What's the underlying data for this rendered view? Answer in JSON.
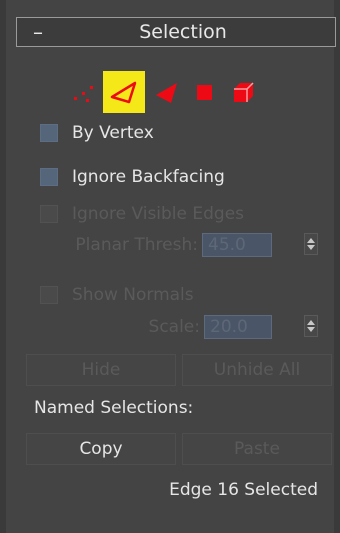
{
  "rollout": {
    "title": "Selection",
    "collapse_glyph": "–"
  },
  "selection_levels": [
    {
      "name": "vertex-icon",
      "active": false
    },
    {
      "name": "edge-icon",
      "active": true
    },
    {
      "name": "border-icon",
      "active": false
    },
    {
      "name": "polygon-icon",
      "active": false
    },
    {
      "name": "element-icon",
      "active": false
    }
  ],
  "options": {
    "by_vertex": {
      "label": "By Vertex",
      "checked": false,
      "enabled": true
    },
    "ignore_backfacing": {
      "label": "Ignore Backfacing",
      "checked": false,
      "enabled": true
    },
    "ignore_visible_edges": {
      "label": "Ignore Visible Edges",
      "checked": false,
      "enabled": false
    },
    "show_normals": {
      "label": "Show Normals",
      "checked": false,
      "enabled": false
    }
  },
  "planar_thresh": {
    "label": "Planar Thresh:",
    "value": "45.0"
  },
  "scale": {
    "label": "Scale:",
    "value": "20.0"
  },
  "buttons": {
    "hide": "Hide",
    "unhide_all": "Unhide All",
    "copy": "Copy",
    "paste": "Paste"
  },
  "named_selections_label": "Named Selections:",
  "status": "Edge 16 Selected",
  "colors": {
    "accent_active": "#f4e818",
    "icon_red": "#ee0a14",
    "panel_bg": "#444444"
  }
}
